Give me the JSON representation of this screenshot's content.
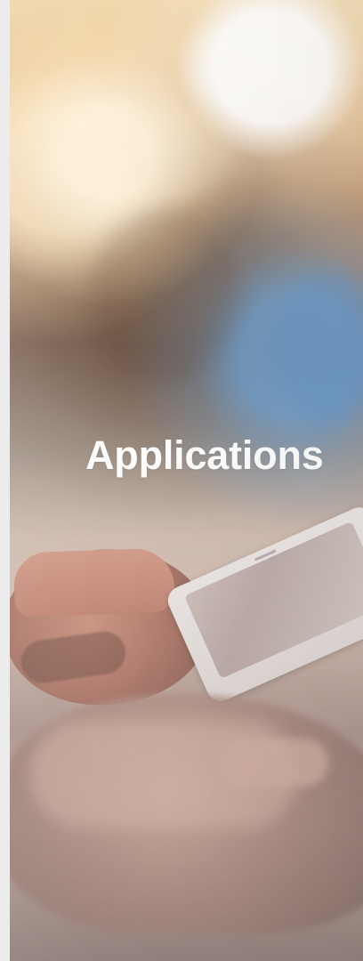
{
  "hero": {
    "title": "Applications"
  },
  "visual": {
    "left_strip_color": "#ececec",
    "title_color": "#ffffff"
  }
}
